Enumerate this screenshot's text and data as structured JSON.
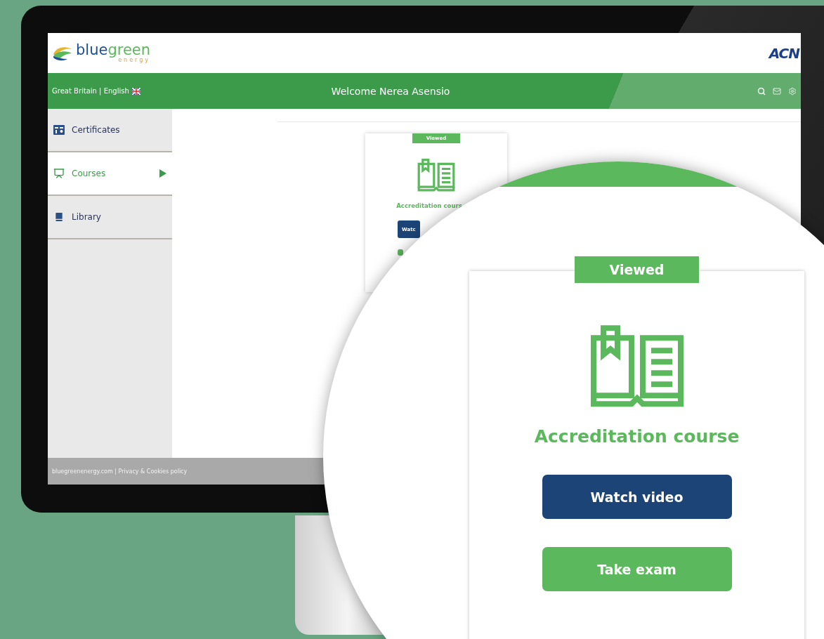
{
  "header": {
    "logo_parts": [
      "blue",
      "green"
    ],
    "logo_subtext": "energy",
    "partner_logo": "ACN"
  },
  "navbar": {
    "locale": "Great Britain | English",
    "welcome": "Welcome Nerea Asensio"
  },
  "sidebar": {
    "items": [
      {
        "label": "Certificates",
        "selected": false
      },
      {
        "label": "Courses",
        "selected": true
      },
      {
        "label": "Library",
        "selected": false
      }
    ]
  },
  "course_card": {
    "badge": "Viewed",
    "title": "Accreditation cours",
    "buttons": [
      {
        "label": "Watc",
        "kind": "primary"
      },
      {
        "kind": "secondary"
      }
    ]
  },
  "footer": {
    "text": "bluegreenenergy.com | Privacy & Cookies policy"
  },
  "zoom_card": {
    "badge": "Viewed",
    "title": "Accreditation course",
    "buttons": [
      {
        "label": "Watch video",
        "kind": "primary"
      },
      {
        "label": "Take exam",
        "kind": "secondary"
      }
    ]
  }
}
